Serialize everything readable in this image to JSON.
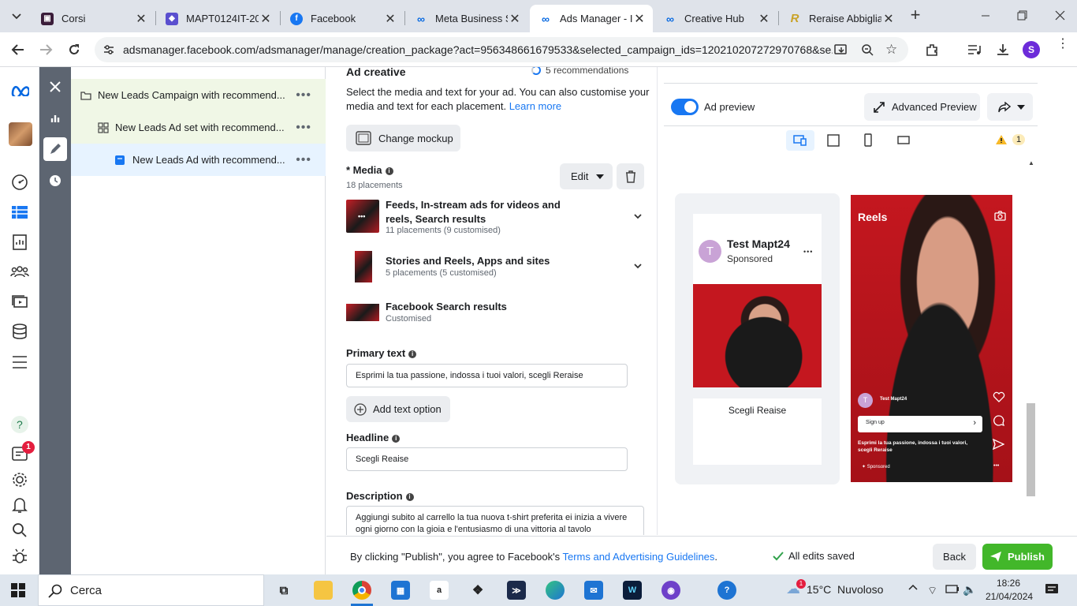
{
  "browser": {
    "tabs": [
      {
        "title": "Corsi",
        "icon": "corsi-favicon",
        "color": "#3b1d3a"
      },
      {
        "title": "MAPT0124IT-20",
        "icon": "mapt-favicon",
        "color": "#5a4fcf"
      },
      {
        "title": "Facebook",
        "icon": "facebook-favicon",
        "color": "#1877f2"
      },
      {
        "title": "Meta Business S",
        "icon": "meta-favicon",
        "color": "#0668e1"
      },
      {
        "title": "Ads Manager - I",
        "icon": "meta-favicon",
        "color": "#0668e1"
      },
      {
        "title": "Creative Hub",
        "icon": "meta-favicon",
        "color": "#0668e1"
      },
      {
        "title": "Reraise Abbiglia",
        "icon": "reraise-favicon",
        "color": "#c9a227"
      }
    ],
    "url": "adsmanager.facebook.com/adsmanager/manage/creation_package?act=956348661679533&selected_campaign_ids=120210207272970768&se...",
    "profile_initial": "S"
  },
  "rail": {
    "notification_count": "1"
  },
  "tree": {
    "campaign": "New Leads Campaign with recommend...",
    "adset": "New Leads Ad set with recommend...",
    "ad": "New Leads Ad with recommend..."
  },
  "editor": {
    "section_title": "Ad creative",
    "recommendations": "5 recommendations",
    "intro": "Select the media and text for your ad. You can also customise your media and text for each placement.",
    "learn_more": "Learn more",
    "change_mockup": "Change mockup",
    "media_label": "* Media",
    "media_placements": "18 placements",
    "edit_label": "Edit",
    "media_groups": [
      {
        "title": "Feeds, In-stream ads for videos and reels, Search results",
        "detail": "11 placements (9 customised)"
      },
      {
        "title": "Stories and Reels, Apps and sites",
        "detail": "5 placements (5 customised)"
      },
      {
        "title": "Facebook Search results",
        "detail": "Customised"
      }
    ],
    "primary_text_label": "Primary text",
    "primary_text_value": "Esprimi la tua passione, indossa i tuoi valori, scegli Reraise",
    "add_text_option": "Add text option",
    "headline_label": "Headline",
    "headline_value": "Scegli Reaise",
    "description_label": "Description",
    "description_value": "Aggiungi subito al carrello la tua nuova t-shirt preferita ei inizia a vivere ogni giorno con la gioia e l'entusiasmo di una vittoria al tavolo"
  },
  "preview": {
    "toggle_label": "Ad preview",
    "advanced_preview": "Advanced Preview",
    "warning_count": "1",
    "feed": {
      "page_name": "Test Mapt24",
      "sponsored": "Sponsored",
      "avatar_initial": "T",
      "headline": "Scegli Reaise"
    },
    "reels": {
      "title": "Reels",
      "page_name": "Test Mapt24",
      "avatar_initial": "T",
      "cta": "Sign up",
      "caption": "Esprimi la tua passione, indossa i tuoi valori, scegli Reraise",
      "sponsored": "Sponsored"
    }
  },
  "footer": {
    "terms_prefix": "By clicking \"Publish\", you agree to Facebook's",
    "terms_link": "Terms and Advertising Guidelines",
    "terms_suffix": ".",
    "saved_status": "All edits saved",
    "back": "Back",
    "publish": "Publish"
  },
  "taskbar": {
    "search_placeholder": "Cerca",
    "weather": "15°C  Nuvoloso",
    "time": "18:26",
    "date": "21/04/2024",
    "weather_badge": "1"
  }
}
